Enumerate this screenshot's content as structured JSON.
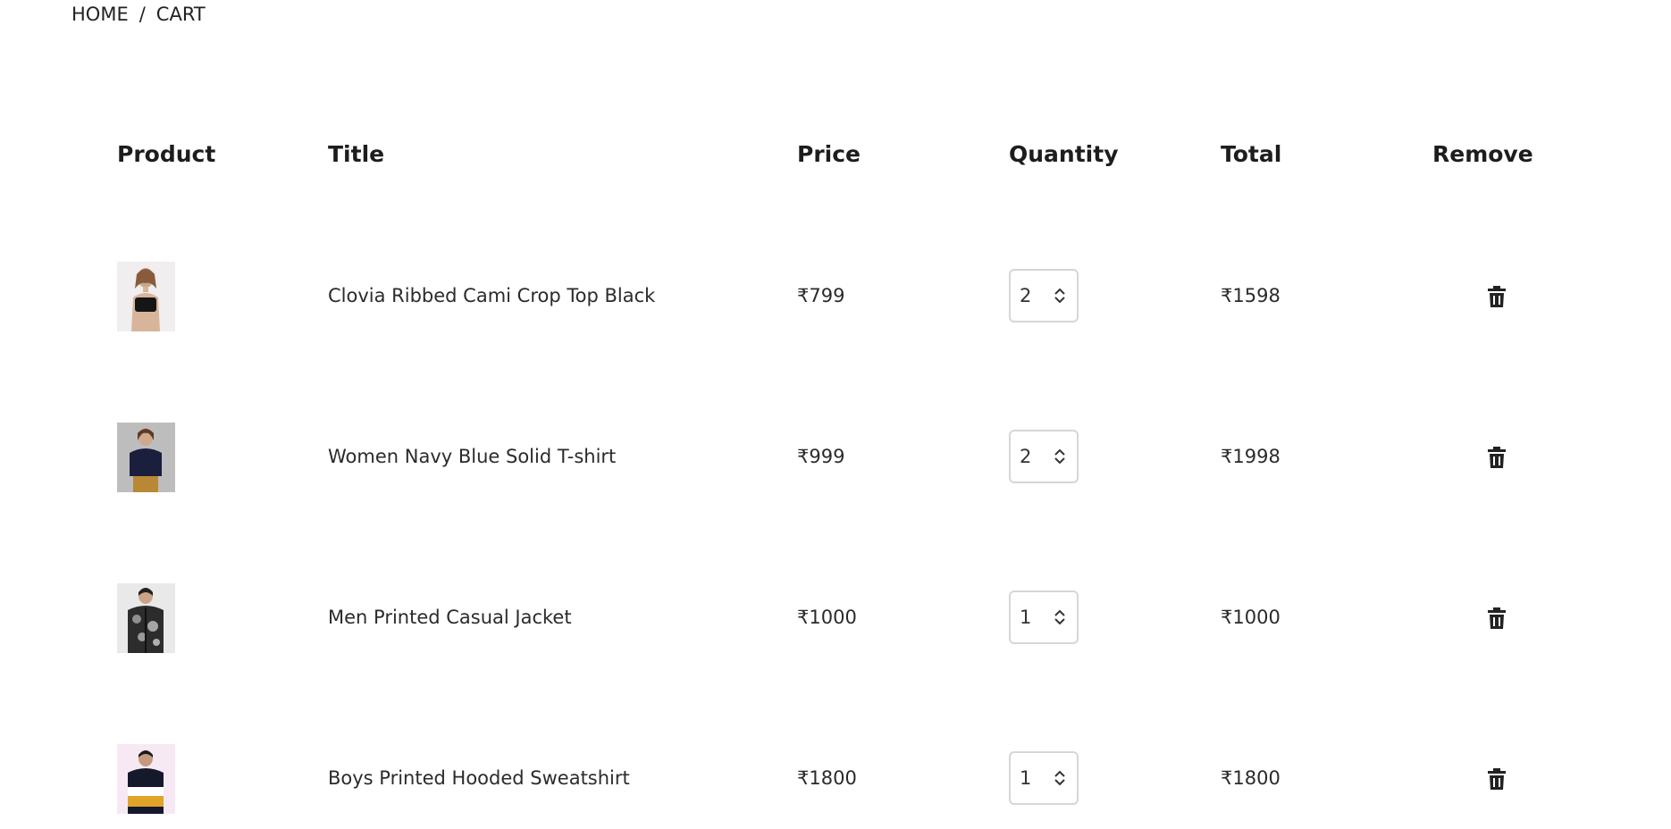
{
  "breadcrumb": {
    "home": "HOME",
    "separator": "/",
    "current": "CART"
  },
  "table": {
    "headers": {
      "product": "Product",
      "title": "Title",
      "price": "Price",
      "quantity": "Quantity",
      "total": "Total",
      "remove": "Remove"
    },
    "rows": [
      {
        "title": "Clovia Ribbed Cami Crop Top Black",
        "price": "₹799",
        "quantity": "2",
        "total": "₹1598",
        "image": "woman-black-crop-top"
      },
      {
        "title": "Women Navy Blue Solid T-shirt",
        "price": "₹999",
        "quantity": "2",
        "total": "₹1998",
        "image": "woman-navy-tshirt"
      },
      {
        "title": "Men Printed Casual Jacket",
        "price": "₹1000",
        "quantity": "1",
        "total": "₹1000",
        "image": "man-printed-jacket"
      },
      {
        "title": "Boys Printed Hooded Sweatshirt",
        "price": "₹1800",
        "quantity": "1",
        "total": "₹1800",
        "image": "boy-hooded-sweatshirt"
      }
    ]
  },
  "icons": {
    "remove": "trash-icon",
    "increment": "chevron-up-icon",
    "decrement": "chevron-down-icon"
  }
}
